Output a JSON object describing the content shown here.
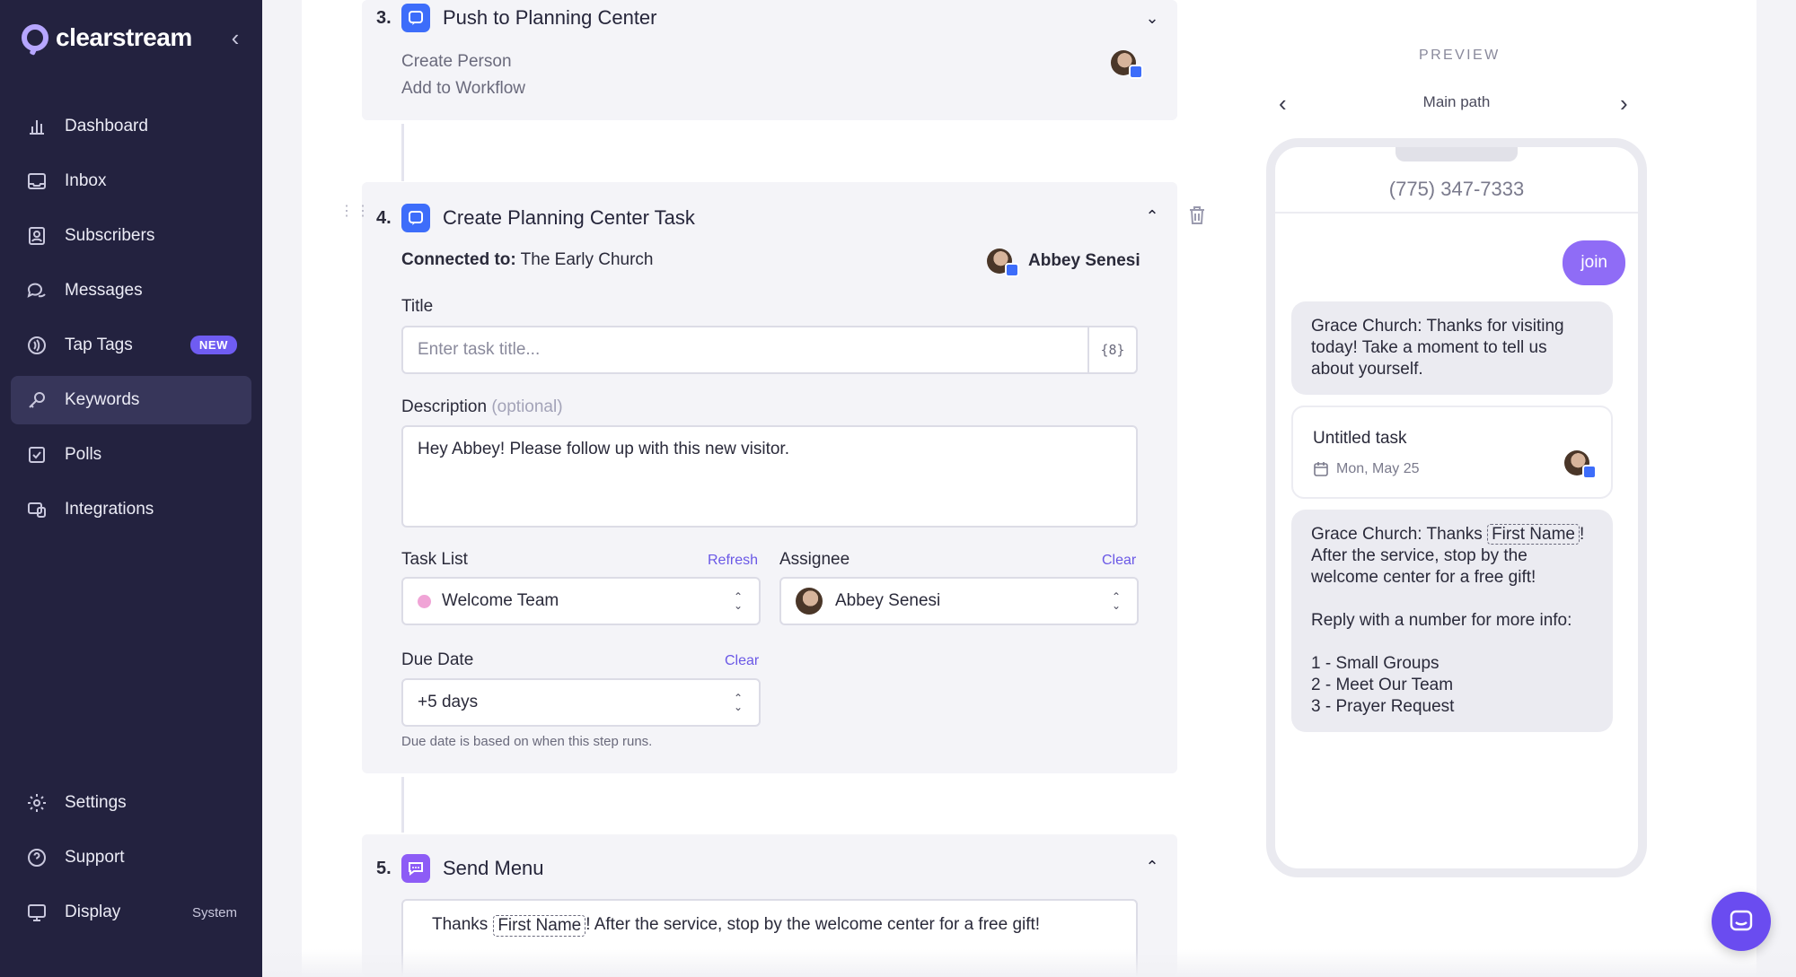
{
  "app": {
    "brand": "clearstream"
  },
  "sidebar": {
    "items": [
      {
        "label": "Dashboard",
        "icon": "bar-chart-icon"
      },
      {
        "label": "Inbox",
        "icon": "inbox-icon"
      },
      {
        "label": "Subscribers",
        "icon": "contacts-icon"
      },
      {
        "label": "Messages",
        "icon": "chat-bubbles-icon"
      },
      {
        "label": "Tap Tags",
        "icon": "tap-tag-icon",
        "badge": "NEW"
      },
      {
        "label": "Keywords",
        "icon": "key-icon",
        "active": true
      },
      {
        "label": "Polls",
        "icon": "checkbox-icon"
      },
      {
        "label": "Integrations",
        "icon": "integrations-icon"
      }
    ],
    "bottom": [
      {
        "label": "Settings",
        "icon": "gear-icon"
      },
      {
        "label": "Support",
        "icon": "help-icon"
      },
      {
        "label": "Display",
        "icon": "monitor-icon",
        "value": "System"
      }
    ]
  },
  "steps": {
    "step3": {
      "number": "3.",
      "title": "Push to Planning Center",
      "lines": [
        "Create Person",
        "Add to Workflow"
      ]
    },
    "step4": {
      "number": "4.",
      "title": "Create Planning Center Task",
      "connected_label": "Connected to:",
      "connected_value": "The Early Church",
      "owner": "Abbey Senesi",
      "title_label": "Title",
      "title_placeholder": "Enter task title...",
      "var_button": "{8}",
      "description_label": "Description",
      "description_optional": "(optional)",
      "description_value": "Hey Abbey! Please follow up with this new visitor.",
      "task_list_label": "Task List",
      "task_list_action": "Refresh",
      "task_list_value": "Welcome Team",
      "assignee_label": "Assignee",
      "assignee_action": "Clear",
      "assignee_value": "Abbey Senesi",
      "due_label": "Due Date",
      "due_action": "Clear",
      "due_value": "+5 days",
      "due_hint": "Due date is based on when this step runs."
    },
    "step5": {
      "number": "5.",
      "title": "Send Menu",
      "message_prefix": "Thanks",
      "message_token": "First Name",
      "message_suffix": "! After the service, stop by the welcome center for a free gift!"
    }
  },
  "preview": {
    "label": "PREVIEW",
    "path": "Main path",
    "phone_number": "(775) 347-7333",
    "outgoing": "join",
    "msg1": "Grace Church: Thanks for visiting today! Take a moment to tell us about yourself.",
    "task_title": "Untitled task",
    "task_date": "Mon, May 25",
    "msg2_prefix": "Grace Church: Thanks",
    "msg2_token": "First Name",
    "msg2_after": "!",
    "msg2_line2": "After the service, stop by the welcome center for a free gift!",
    "msg2_reply": "Reply with a number for more info:",
    "menu": [
      "1 - Small Groups",
      "2 - Meet Our Team",
      "3 - Prayer Request"
    ]
  },
  "colors": {
    "sidebar": "#23223f",
    "accent": "#6f5cf2",
    "planning_center": "#3d6dfa"
  }
}
